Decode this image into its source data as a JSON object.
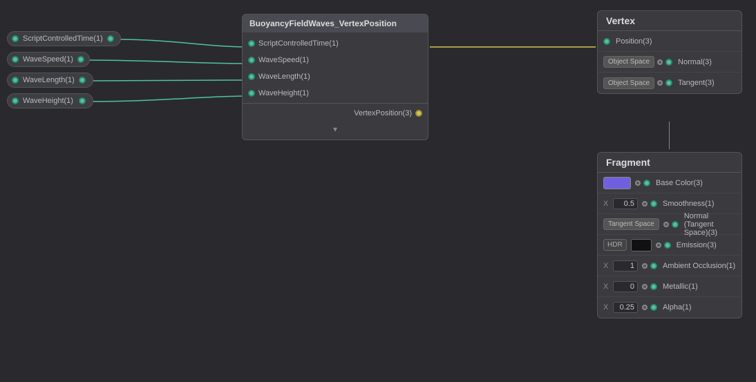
{
  "leftNodes": [
    {
      "id": "script-controlled-time",
      "label": "ScriptControlledTime(1)"
    },
    {
      "id": "wave-speed",
      "label": "WaveSpeed(1)"
    },
    {
      "id": "wave-length",
      "label": "WaveLength(1)"
    },
    {
      "id": "wave-height",
      "label": "WaveHeight(1)"
    }
  ],
  "mainNode": {
    "title": "BuoyancyFieldWaves_VertexPosition",
    "inputs": [
      {
        "label": "ScriptControlledTime(1)"
      },
      {
        "label": "WaveSpeed(1)"
      },
      {
        "label": "WaveLength(1)"
      },
      {
        "label": "WaveHeight(1)"
      }
    ],
    "outputs": [
      {
        "label": "VertexPosition(3)"
      }
    ]
  },
  "vertexPanel": {
    "title": "Vertex",
    "rows": [
      {
        "id": "position",
        "label": "Position(3)",
        "hasTag": false,
        "tagLabel": ""
      },
      {
        "id": "normal",
        "label": "Normal(3)",
        "hasTag": true,
        "tagLabel": "Object Space"
      },
      {
        "id": "tangent",
        "label": "Tangent(3)",
        "hasTag": true,
        "tagLabel": "Object Space"
      }
    ]
  },
  "fragmentPanel": {
    "title": "Fragment",
    "rows": [
      {
        "id": "base-color",
        "label": "Base Color(3)",
        "type": "color",
        "value": ""
      },
      {
        "id": "smoothness",
        "label": "Smoothness(1)",
        "type": "number",
        "prefix": "X",
        "value": "0.5"
      },
      {
        "id": "normal-tangent",
        "label": "Normal (Tangent Space)(3)",
        "type": "tag",
        "tagLabel": "Tangent Space"
      },
      {
        "id": "emission",
        "label": "Emission(3)",
        "type": "hdr",
        "tagLabel": "HDR"
      },
      {
        "id": "ambient-occlusion",
        "label": "Ambient Occlusion(1)",
        "type": "number",
        "prefix": "X",
        "value": "1"
      },
      {
        "id": "metallic",
        "label": "Metallic(1)",
        "type": "number",
        "prefix": "X",
        "value": "0"
      },
      {
        "id": "alpha",
        "label": "Alpha(1)",
        "type": "number",
        "prefix": "X",
        "value": "0.25"
      }
    ]
  },
  "icons": {
    "chevron_down": "▾",
    "expand": "▾"
  }
}
